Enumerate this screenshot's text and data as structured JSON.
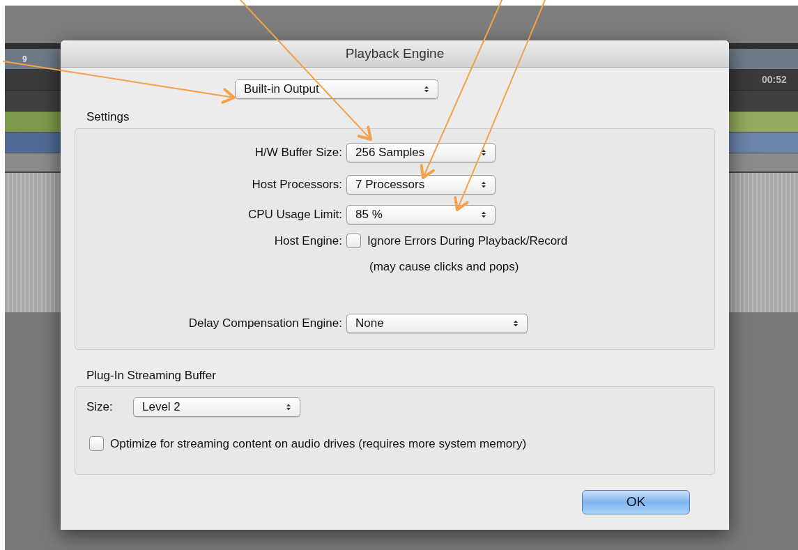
{
  "background": {
    "ruler_label": "9",
    "timecode": "00:52"
  },
  "dialog": {
    "title": "Playback Engine",
    "device": {
      "value": "Built-in Output"
    },
    "settings": {
      "title": "Settings",
      "selects": [
        {
          "label": "H/W Buffer Size:",
          "value": "256 Samples"
        },
        {
          "label": "Host Processors:",
          "value": "7 Processors"
        },
        {
          "label": "CPU Usage Limit:",
          "value": "85 %"
        }
      ],
      "host_engine": {
        "label": "Host Engine:",
        "option": "Ignore Errors During Playback/Record",
        "checked": false,
        "note": "(may cause clicks and pops)"
      },
      "delay_compensation": {
        "label": "Delay Compensation Engine:",
        "value": "None"
      }
    },
    "streaming": {
      "title": "Plug-In Streaming Buffer",
      "size_label": "Size:",
      "size_value": "Level 2",
      "optimize": {
        "label": "Optimize for streaming content on audio drives (requires more system memory)",
        "checked": false
      }
    },
    "ok_button": "OK"
  }
}
